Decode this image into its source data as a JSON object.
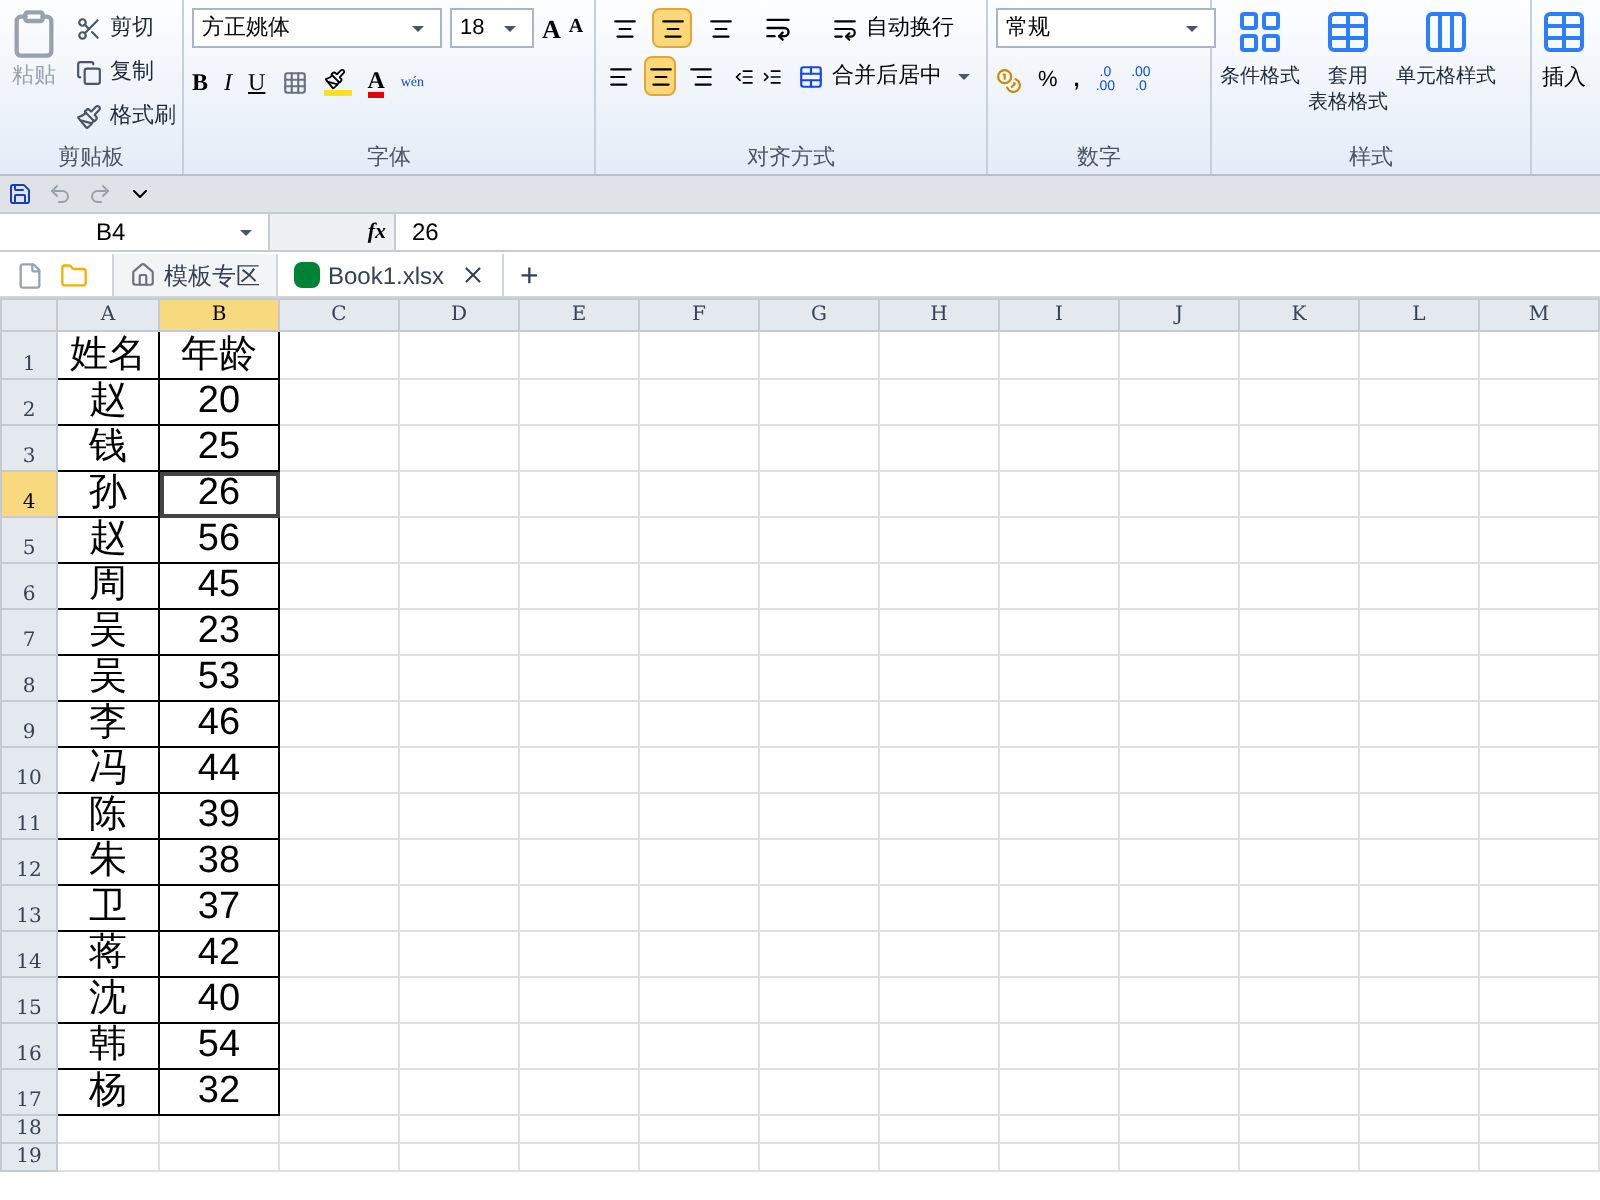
{
  "ribbon": {
    "groups": [
      {
        "kind": "clipboard",
        "label": "剪贴板",
        "paste": "粘贴",
        "items": [
          "剪切",
          "复制",
          "格式刷"
        ]
      },
      {
        "kind": "font",
        "label": "字体",
        "font_name": "方正姚体",
        "font_size": "18",
        "grow": "A",
        "shrink": "A",
        "bold": "B",
        "italic": "I",
        "underline": "U",
        "font_color": "A",
        "wen": "wén"
      },
      {
        "kind": "align",
        "label": "对齐方式",
        "wrap": "自动换行",
        "merge": "合并后居中",
        "vertical": [
          {
            "selected": false
          },
          {
            "selected": true
          },
          {
            "selected": false
          }
        ],
        "horizontal": [
          {
            "selected": false
          },
          {
            "selected": true
          },
          {
            "selected": false
          }
        ]
      },
      {
        "kind": "number",
        "label": "数字",
        "format": "常规",
        "percent": "%",
        "comma": ",",
        "increase_decimal": [
          ".0",
          ".00"
        ],
        "decrease_decimal": [
          ".00",
          ".0"
        ]
      },
      {
        "kind": "styles",
        "label": "样式",
        "buttons": [
          [
            "条件格式"
          ],
          [
            "套用",
            "表格格式"
          ],
          [
            "单元格样式"
          ]
        ]
      },
      {
        "kind": "cells",
        "buttons": [
          "插入"
        ]
      }
    ]
  },
  "formula_bar": {
    "name_box": "B4",
    "fx": "fx",
    "value": "26"
  },
  "tabs": [
    {
      "label": "模板专区",
      "kind": "home",
      "selected": false
    },
    {
      "label": "Book1.xlsx",
      "kind": "file",
      "selected": true
    }
  ],
  "add_tab": "+",
  "columns": [
    {
      "label": "A",
      "selected": false
    },
    {
      "label": "B",
      "selected": true
    },
    {
      "label": "C",
      "selected": false
    },
    {
      "label": "D",
      "selected": false
    },
    {
      "label": "E",
      "selected": false
    },
    {
      "label": "F",
      "selected": false
    },
    {
      "label": "G",
      "selected": false
    },
    {
      "label": "H",
      "selected": false
    },
    {
      "label": "I",
      "selected": false
    },
    {
      "label": "J",
      "selected": false
    },
    {
      "label": "K",
      "selected": false
    },
    {
      "label": "L",
      "selected": false
    },
    {
      "label": "M",
      "selected": false
    }
  ],
  "rows": [
    {
      "number": "1",
      "selected": false,
      "cells": [
        "姓名",
        "年龄"
      ]
    },
    {
      "number": "2",
      "selected": false,
      "cells": [
        "赵",
        "20"
      ]
    },
    {
      "number": "3",
      "selected": false,
      "cells": [
        "钱",
        "25"
      ]
    },
    {
      "number": "4",
      "selected": true,
      "cells": [
        "孙",
        "26"
      ]
    },
    {
      "number": "5",
      "selected": false,
      "cells": [
        "赵",
        "56"
      ]
    },
    {
      "number": "6",
      "selected": false,
      "cells": [
        "周",
        "45"
      ]
    },
    {
      "number": "7",
      "selected": false,
      "cells": [
        "吴",
        "23"
      ]
    },
    {
      "number": "8",
      "selected": false,
      "cells": [
        "吴",
        "53"
      ]
    },
    {
      "number": "9",
      "selected": false,
      "cells": [
        "李",
        "46"
      ]
    },
    {
      "number": "10",
      "selected": false,
      "cells": [
        "冯",
        "44"
      ]
    },
    {
      "number": "11",
      "selected": false,
      "cells": [
        "陈",
        "39"
      ]
    },
    {
      "number": "12",
      "selected": false,
      "cells": [
        "朱",
        "38"
      ]
    },
    {
      "number": "13",
      "selected": false,
      "cells": [
        "卫",
        "37"
      ]
    },
    {
      "number": "14",
      "selected": false,
      "cells": [
        "蒋",
        "42"
      ]
    },
    {
      "number": "15",
      "selected": false,
      "cells": [
        "沈",
        "40"
      ]
    },
    {
      "number": "16",
      "selected": false,
      "cells": [
        "韩",
        "54"
      ]
    },
    {
      "number": "17",
      "selected": false,
      "cells": [
        "杨",
        "32"
      ]
    },
    {
      "number": "18",
      "selected": false,
      "cells": []
    },
    {
      "number": "19",
      "selected": false,
      "cells": []
    }
  ]
}
